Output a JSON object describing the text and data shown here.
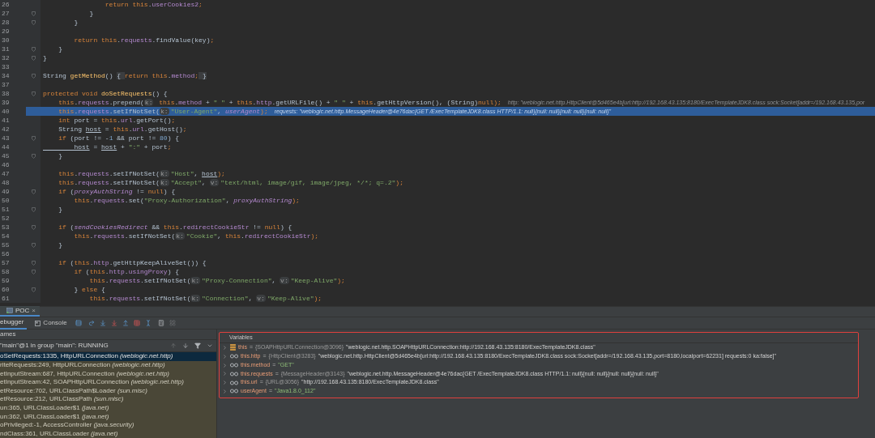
{
  "editor": {
    "lines": [
      {
        "number": "26",
        "fold": false,
        "selected": false,
        "segments": [
          {
            "text": "                return ",
            "kind": "kw"
          },
          {
            "text": "this",
            "kind": "kw"
          },
          {
            "text": ".",
            "kind": "p"
          },
          {
            "text": "userCookies2",
            "kind": "f"
          },
          {
            "text": ";",
            "kind": "kw"
          }
        ]
      },
      {
        "number": "27",
        "fold": true,
        "selected": false,
        "segments": [
          {
            "text": "            }",
            "kind": "p"
          }
        ]
      },
      {
        "number": "28",
        "fold": true,
        "selected": false,
        "segments": [
          {
            "text": "        }",
            "kind": "p"
          }
        ]
      },
      {
        "number": "29",
        "fold": false,
        "selected": false
      },
      {
        "number": "30",
        "fold": false,
        "selected": false,
        "segments": [
          {
            "text": "        return ",
            "kind": "kw"
          },
          {
            "text": "this",
            "kind": "kw"
          },
          {
            "text": ".",
            "kind": "p"
          },
          {
            "text": "requests",
            "kind": "f"
          },
          {
            "text": ".findValue(key)",
            "kind": "p"
          },
          {
            "text": ";",
            "kind": "kw"
          }
        ]
      },
      {
        "number": "31",
        "fold": true,
        "selected": false,
        "segments": [
          {
            "text": "    }",
            "kind": "p"
          }
        ]
      },
      {
        "number": "32",
        "fold": true,
        "selected": false,
        "segments": [
          {
            "text": "}",
            "kind": "p"
          }
        ]
      },
      {
        "number": "33",
        "fold": false,
        "selected": false
      },
      {
        "number": "34",
        "fold": true,
        "selected": false,
        "segments": [
          {
            "text": "String ",
            "kind": "p"
          },
          {
            "text": "getMethod",
            "kind": "m"
          },
          {
            "text": "() ",
            "kind": "p"
          },
          {
            "text": "{ ",
            "kind": "fb"
          },
          {
            "text": "return ",
            "kind": "kw"
          },
          {
            "text": "this",
            "kind": "kw"
          },
          {
            "text": ".",
            "kind": "p"
          },
          {
            "text": "method",
            "kind": "f"
          },
          {
            "text": ";",
            "kind": "kw"
          },
          {
            "text": " }",
            "kind": "fb"
          }
        ]
      },
      {
        "number": "37",
        "fold": false,
        "selected": false
      },
      {
        "number": "38",
        "fold": true,
        "selected": false,
        "segments": [
          {
            "text": "protected void ",
            "kind": "kw"
          },
          {
            "text": "doSetRequests",
            "kind": "m"
          },
          {
            "text": "() {",
            "kind": "p"
          }
        ]
      },
      {
        "number": "39",
        "fold": false,
        "selected": false,
        "segments": [
          {
            "text": "    this",
            "kind": "kw"
          },
          {
            "text": ".",
            "kind": "p"
          },
          {
            "text": "requests",
            "kind": "f"
          },
          {
            "text": ".prepend(",
            "kind": "p"
          },
          {
            "text": "k:",
            "kind": "ph"
          },
          {
            "text": " this",
            "kind": "kw"
          },
          {
            "text": ".",
            "kind": "p"
          },
          {
            "text": "method",
            "kind": "f"
          },
          {
            "text": " + ",
            "kind": "p"
          },
          {
            "text": "\" \"",
            "kind": "s"
          },
          {
            "text": " + ",
            "kind": "p"
          },
          {
            "text": "this",
            "kind": "kw"
          },
          {
            "text": ".",
            "kind": "p"
          },
          {
            "text": "http",
            "kind": "f"
          },
          {
            "text": ".getURLFile() + ",
            "kind": "p"
          },
          {
            "text": "\" \"",
            "kind": "s"
          },
          {
            "text": " + ",
            "kind": "p"
          },
          {
            "text": "this",
            "kind": "kw"
          },
          {
            "text": ".getHttpVersion(), (String)",
            "kind": "p"
          },
          {
            "text": "null",
            "kind": "kw"
          },
          {
            "text": ");",
            "kind": "kw"
          }
        ],
        "hint": "http: \"weblogic.net.http.HttpClient@5d465e4b[url:http://192.168.43.135:8180/ExecTemplateJDK8.class sock:Socket[addr=/192.168.43.135,por"
      },
      {
        "number": "40",
        "fold": false,
        "selected": true,
        "segments": [
          {
            "text": "    this",
            "kind": "kw"
          },
          {
            "text": ".",
            "kind": "p"
          },
          {
            "text": "requests",
            "kind": "f"
          },
          {
            "text": ".setIfNotSet(",
            "kind": "p"
          },
          {
            "text": "k:",
            "kind": "ph"
          },
          {
            "text": "\"User-Agent\"",
            "kind": "s"
          },
          {
            "text": ", ",
            "kind": "p"
          },
          {
            "text": "userAgent",
            "kind": "i"
          },
          {
            "text": ");",
            "kind": "kw"
          }
        ],
        "hint": "requests: \"weblogic.net.http.MessageHeader@4e76dac{GET /ExecTemplateJDK8.class HTTP/1.1: null}{null: null}{null: null}{null: null}\""
      },
      {
        "number": "41",
        "fold": false,
        "selected": false,
        "segments": [
          {
            "text": "    int ",
            "kind": "kw"
          },
          {
            "text": "port = ",
            "kind": "p"
          },
          {
            "text": "this",
            "kind": "kw"
          },
          {
            "text": ".",
            "kind": "p"
          },
          {
            "text": "url",
            "kind": "f"
          },
          {
            "text": ".getPort()",
            "kind": "p"
          },
          {
            "text": ";",
            "kind": "kw"
          }
        ]
      },
      {
        "number": "42",
        "fold": false,
        "selected": false,
        "segments": [
          {
            "text": "    String ",
            "kind": "p"
          },
          {
            "text": "host",
            "kind": "u"
          },
          {
            "text": " = ",
            "kind": "p"
          },
          {
            "text": "this",
            "kind": "kw"
          },
          {
            "text": ".",
            "kind": "p"
          },
          {
            "text": "url",
            "kind": "f"
          },
          {
            "text": ".getHost()",
            "kind": "p"
          },
          {
            "text": ";",
            "kind": "kw"
          }
        ]
      },
      {
        "number": "43",
        "fold": true,
        "selected": false,
        "segments": [
          {
            "text": "    if ",
            "kind": "kw"
          },
          {
            "text": "(port != -",
            "kind": "p"
          },
          {
            "text": "1 ",
            "kind": "n"
          },
          {
            "text": "&& port != ",
            "kind": "p"
          },
          {
            "text": "80",
            "kind": "n"
          },
          {
            "text": ") {",
            "kind": "p"
          }
        ]
      },
      {
        "number": "44",
        "fold": false,
        "selected": false,
        "segments": [
          {
            "text": "        host",
            "kind": "u"
          },
          {
            "text": " = ",
            "kind": "p"
          },
          {
            "text": "host",
            "kind": "u"
          },
          {
            "text": " + ",
            "kind": "p"
          },
          {
            "text": "\":\"",
            "kind": "s"
          },
          {
            "text": " + port",
            "kind": "p"
          },
          {
            "text": ";",
            "kind": "kw"
          }
        ]
      },
      {
        "number": "45",
        "fold": true,
        "selected": false,
        "segments": [
          {
            "text": "    }",
            "kind": "p"
          }
        ]
      },
      {
        "number": "46",
        "fold": false,
        "selected": false
      },
      {
        "number": "47",
        "fold": false,
        "selected": false,
        "segments": [
          {
            "text": "    this",
            "kind": "kw"
          },
          {
            "text": ".",
            "kind": "p"
          },
          {
            "text": "requests",
            "kind": "f"
          },
          {
            "text": ".setIfNotSet(",
            "kind": "p"
          },
          {
            "text": "k:",
            "kind": "ph"
          },
          {
            "text": "\"Host\"",
            "kind": "s"
          },
          {
            "text": ", ",
            "kind": "p"
          },
          {
            "text": "host",
            "kind": "u"
          },
          {
            "text": ");",
            "kind": "kw"
          }
        ]
      },
      {
        "number": "48",
        "fold": false,
        "selected": false,
        "segments": [
          {
            "text": "    this",
            "kind": "kw"
          },
          {
            "text": ".",
            "kind": "p"
          },
          {
            "text": "requests",
            "kind": "f"
          },
          {
            "text": ".setIfNotSet(",
            "kind": "p"
          },
          {
            "text": "k:",
            "kind": "ph"
          },
          {
            "text": "\"Accept\"",
            "kind": "s"
          },
          {
            "text": ", ",
            "kind": "p"
          },
          {
            "text": "v:",
            "kind": "ph"
          },
          {
            "text": "\"text/html, image/gif, image/jpeg, */*; q=.2\"",
            "kind": "s"
          },
          {
            "text": ");",
            "kind": "kw"
          }
        ]
      },
      {
        "number": "49",
        "fold": true,
        "selected": false,
        "segments": [
          {
            "text": "    if ",
            "kind": "kw"
          },
          {
            "text": "(",
            "kind": "p"
          },
          {
            "text": "proxyAuthString",
            "kind": "i"
          },
          {
            "text": " != ",
            "kind": "p"
          },
          {
            "text": "null",
            "kind": "kw"
          },
          {
            "text": ") {",
            "kind": "p"
          }
        ]
      },
      {
        "number": "50",
        "fold": false,
        "selected": false,
        "segments": [
          {
            "text": "        this",
            "kind": "kw"
          },
          {
            "text": ".",
            "kind": "p"
          },
          {
            "text": "requests",
            "kind": "f"
          },
          {
            "text": ".set(",
            "kind": "p"
          },
          {
            "text": "\"Proxy-Authorization\"",
            "kind": "s"
          },
          {
            "text": ", ",
            "kind": "p"
          },
          {
            "text": "proxyAuthString",
            "kind": "i"
          },
          {
            "text": ");",
            "kind": "kw"
          }
        ]
      },
      {
        "number": "51",
        "fold": true,
        "selected": false,
        "segments": [
          {
            "text": "    }",
            "kind": "p"
          }
        ]
      },
      {
        "number": "52",
        "fold": false,
        "selected": false
      },
      {
        "number": "53",
        "fold": true,
        "selected": false,
        "segments": [
          {
            "text": "    if ",
            "kind": "kw"
          },
          {
            "text": "(",
            "kind": "p"
          },
          {
            "text": "sendCookiesRedirect",
            "kind": "i"
          },
          {
            "text": " && ",
            "kind": "p"
          },
          {
            "text": "this",
            "kind": "kw"
          },
          {
            "text": ".",
            "kind": "p"
          },
          {
            "text": "redirectCookieStr",
            "kind": "f"
          },
          {
            "text": " != ",
            "kind": "p"
          },
          {
            "text": "null",
            "kind": "kw"
          },
          {
            "text": ") {",
            "kind": "p"
          }
        ]
      },
      {
        "number": "54",
        "fold": false,
        "selected": false,
        "segments": [
          {
            "text": "        this",
            "kind": "kw"
          },
          {
            "text": ".",
            "kind": "p"
          },
          {
            "text": "requests",
            "kind": "f"
          },
          {
            "text": ".setIfNotSet(",
            "kind": "p"
          },
          {
            "text": "k:",
            "kind": "ph"
          },
          {
            "text": "\"Cookie\"",
            "kind": "s"
          },
          {
            "text": ", ",
            "kind": "p"
          },
          {
            "text": "this",
            "kind": "kw"
          },
          {
            "text": ".",
            "kind": "p"
          },
          {
            "text": "redirectCookieStr",
            "kind": "f"
          },
          {
            "text": ");",
            "kind": "kw"
          }
        ]
      },
      {
        "number": "55",
        "fold": true,
        "selected": false,
        "segments": [
          {
            "text": "    }",
            "kind": "p"
          }
        ]
      },
      {
        "number": "56",
        "fold": false,
        "selected": false
      },
      {
        "number": "57",
        "fold": true,
        "selected": false,
        "segments": [
          {
            "text": "    if ",
            "kind": "kw"
          },
          {
            "text": "(",
            "kind": "p"
          },
          {
            "text": "this",
            "kind": "kw"
          },
          {
            "text": ".",
            "kind": "p"
          },
          {
            "text": "http",
            "kind": "f"
          },
          {
            "text": ".getHttpKeepAliveSet()) {",
            "kind": "p"
          }
        ]
      },
      {
        "number": "58",
        "fold": true,
        "selected": false,
        "segments": [
          {
            "text": "        if ",
            "kind": "kw"
          },
          {
            "text": "(",
            "kind": "p"
          },
          {
            "text": "this",
            "kind": "kw"
          },
          {
            "text": ".",
            "kind": "p"
          },
          {
            "text": "http",
            "kind": "f"
          },
          {
            "text": ".",
            "kind": "p"
          },
          {
            "text": "usingProxy",
            "kind": "f"
          },
          {
            "text": ") {",
            "kind": "p"
          }
        ]
      },
      {
        "number": "59",
        "fold": false,
        "selected": false,
        "segments": [
          {
            "text": "            this",
            "kind": "kw"
          },
          {
            "text": ".",
            "kind": "p"
          },
          {
            "text": "requests",
            "kind": "f"
          },
          {
            "text": ".setIfNotSet(",
            "kind": "p"
          },
          {
            "text": "k:",
            "kind": "ph"
          },
          {
            "text": "\"Proxy-Connection\"",
            "kind": "s"
          },
          {
            "text": ", ",
            "kind": "p"
          },
          {
            "text": "v:",
            "kind": "ph"
          },
          {
            "text": "\"Keep-Alive\"",
            "kind": "s"
          },
          {
            "text": ");",
            "kind": "kw"
          }
        ]
      },
      {
        "number": "60",
        "fold": true,
        "selected": false,
        "segments": [
          {
            "text": "        } ",
            "kind": "p"
          },
          {
            "text": "else ",
            "kind": "kw"
          },
          {
            "text": "{",
            "kind": "p"
          }
        ]
      },
      {
        "number": "61",
        "fold": false,
        "selected": false,
        "segments": [
          {
            "text": "            this",
            "kind": "kw"
          },
          {
            "text": ".",
            "kind": "p"
          },
          {
            "text": "requests",
            "kind": "f"
          },
          {
            "text": ".setIfNotSet(",
            "kind": "p"
          },
          {
            "text": "k:",
            "kind": "ph"
          },
          {
            "text": "\"Connection\"",
            "kind": "s"
          },
          {
            "text": ", ",
            "kind": "p"
          },
          {
            "text": "v:",
            "kind": "ph"
          },
          {
            "text": "\"Keep-Alive\"",
            "kind": "s"
          },
          {
            "text": ");",
            "kind": "kw"
          }
        ]
      }
    ]
  },
  "run_tabs": [
    {
      "label": "POC",
      "selected": true,
      "close": "×"
    }
  ],
  "debug_tabs": [
    {
      "label": "ebugger",
      "selected": true
    },
    {
      "label": "Console",
      "selected": false
    }
  ],
  "frames": {
    "header": "ames",
    "thread": "\"main\"@1 in group \"main\": RUNNING",
    "items": [
      {
        "text": "oSetRequests:1335, HttpURLConnection *(weblogic.net.http)*",
        "selected": true
      },
      {
        "text": "riteRequests:249, HttpURLConnection *(weblogic.net.http)*",
        "selected": false
      },
      {
        "text": "etInputStream:687, HttpURLConnection *(weblogic.net.http)*",
        "selected": false
      },
      {
        "text": "etInputStream:42, SOAPHttpURLConnection *(weblogic.net.http)*",
        "selected": false
      },
      {
        "text": "etResource:702, URLClassPath$Loader *(sun.misc)*",
        "selected": false
      },
      {
        "text": "etResource:212, URLClassPath *(sun.misc)*",
        "selected": false
      },
      {
        "text": "un:365, URLClassLoader$1 *(java.net)*",
        "selected": false
      },
      {
        "text": "un:362, URLClassLoader$1 *(java.net)*",
        "selected": false
      },
      {
        "text": "oPrivileged:-1, AccessController *(java.security)*",
        "selected": false
      },
      {
        "text": "ndClass:361, URLClassLoader *(java.net)*",
        "selected": false
      }
    ]
  },
  "variables": {
    "header": "Variables",
    "items": [
      {
        "kind": "instance",
        "name": "this",
        "equals": "=",
        "type": "{SOAPHttpURLConnection@3096}",
        "value": "\"weblogic.net.http.SOAPHttpURLConnection:http://192.168.43.135:8180/ExecTemplateJDK8.class\""
      },
      {
        "kind": "field",
        "name": "this.http",
        "equals": "=",
        "type": "{HttpClient@3283}",
        "value": "\"weblogic.net.http.HttpClient@5d465e4b[url:http://192.168.43.135:8180/ExecTemplateJDK8.class sock:Socket[addr=/192.168.43.135,port=8180,localport=62231] requests:0 ka:false]\""
      },
      {
        "kind": "field",
        "name": "this.method",
        "equals": "=",
        "value": "\"GET\""
      },
      {
        "kind": "field",
        "name": "this.requests",
        "equals": "=",
        "type": "{MessageHeader@3143}",
        "value": "\"weblogic.net.http.MessageHeader@4e76dac{GET /ExecTemplateJDK8.class HTTP/1.1: null}{null: null}{null: null}{null: null}\""
      },
      {
        "kind": "field",
        "name": "this.url",
        "equals": "=",
        "type": "{URL@3056}",
        "value": "\"http://192.168.43.135:8180/ExecTemplateJDK8.class\""
      },
      {
        "kind": "field",
        "name": "userAgent",
        "equals": "=",
        "value": "\"Java1.8.0_112\""
      }
    ]
  }
}
